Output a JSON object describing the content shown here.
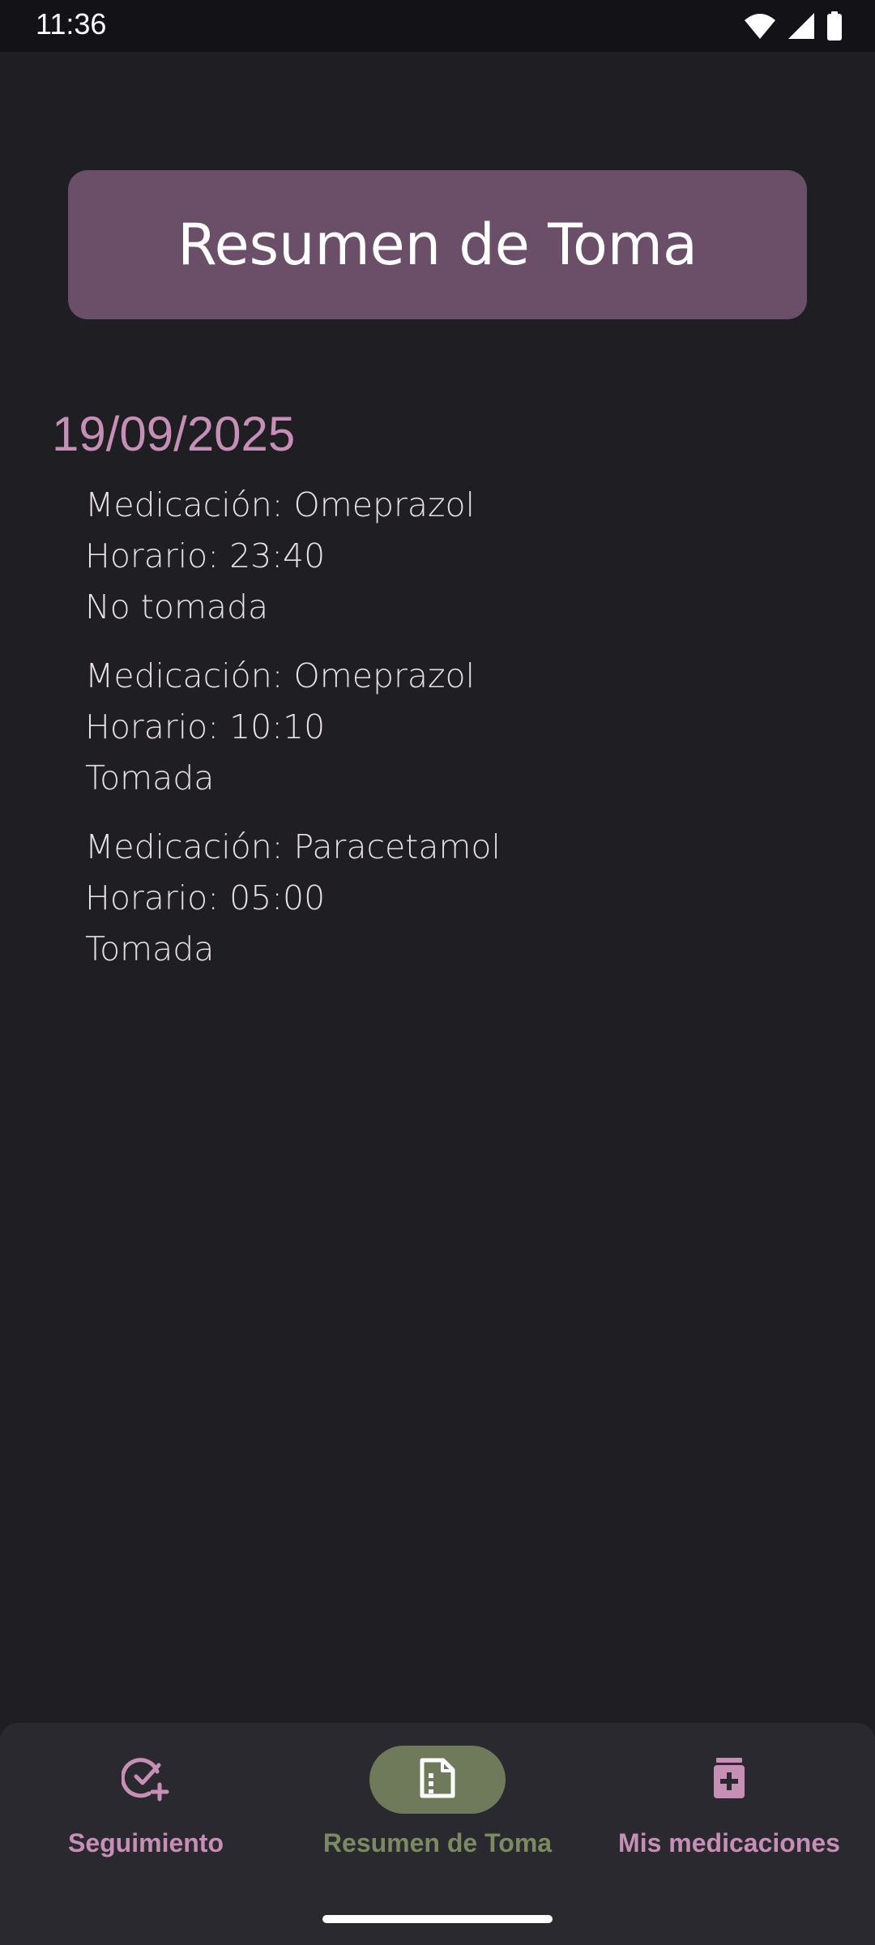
{
  "status_bar": {
    "time": "11:36",
    "icons": [
      "wifi-icon",
      "signal-icon",
      "battery-icon"
    ]
  },
  "header": {
    "title": "Resumen de Toma"
  },
  "date": "19/09/2025",
  "entries": [
    {
      "medication": "Medicación: Omeprazol",
      "schedule": "Horario: 23:40",
      "status": "No tomada"
    },
    {
      "medication": "Medicación: Omeprazol",
      "schedule": "Horario: 10:10",
      "status": "Tomada"
    },
    {
      "medication": "Medicación: Paracetamol",
      "schedule": "Horario: 05:00",
      "status": "Tomada"
    }
  ],
  "bottom_nav": {
    "items": [
      {
        "label": "Seguimiento",
        "icon": "check-circle-add-icon",
        "active": false
      },
      {
        "label": "Resumen de Toma",
        "icon": "document-summary-icon",
        "active": true
      },
      {
        "label": "Mis medicaciones",
        "icon": "medication-bottle-icon",
        "active": false
      }
    ]
  },
  "colors": {
    "background": "#1f1e23",
    "header_card": "#6b4f69",
    "accent_pink": "#c58fb6",
    "active_green": "#6e7a59",
    "nav_background": "#2b2930"
  }
}
